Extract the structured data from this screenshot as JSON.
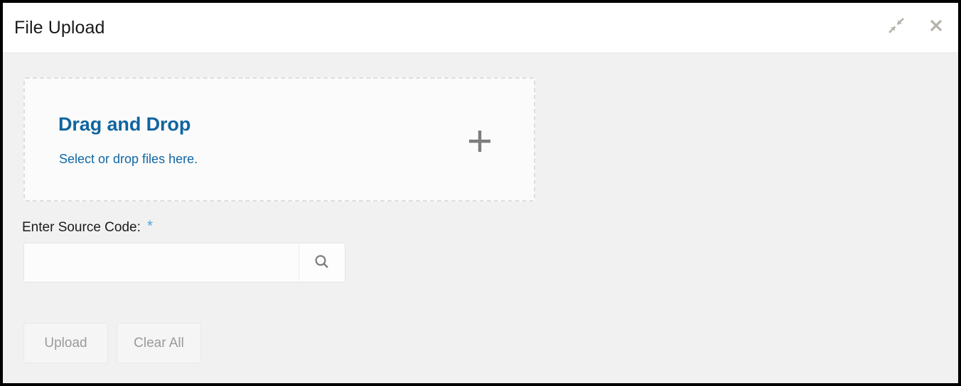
{
  "window": {
    "title": "File Upload",
    "actions": [
      {
        "name": "collapse-icon",
        "label": "Collapse"
      },
      {
        "name": "close-icon",
        "label": "Close"
      }
    ]
  },
  "dropzone": {
    "title": "Drag and Drop",
    "subtitle": "Select or drop files here.",
    "add_icon": "plus-icon"
  },
  "form": {
    "source_code_label": "Enter Source Code:",
    "required_marker": "*",
    "source_code_value": "",
    "source_code_placeholder": "",
    "search_icon": "search-icon"
  },
  "footer": {
    "upload_label": "Upload",
    "clear_all_label": "Clear All"
  },
  "colors": {
    "accent_blue": "#10659f",
    "link_blue": "#1068a5",
    "required_star": "#4fa8d8",
    "body_bg": "#f1f1f1",
    "icon_gray": "#b5b2aa",
    "plus_gray": "#7d7d7d",
    "disabled_text": "#9a9a9a"
  }
}
